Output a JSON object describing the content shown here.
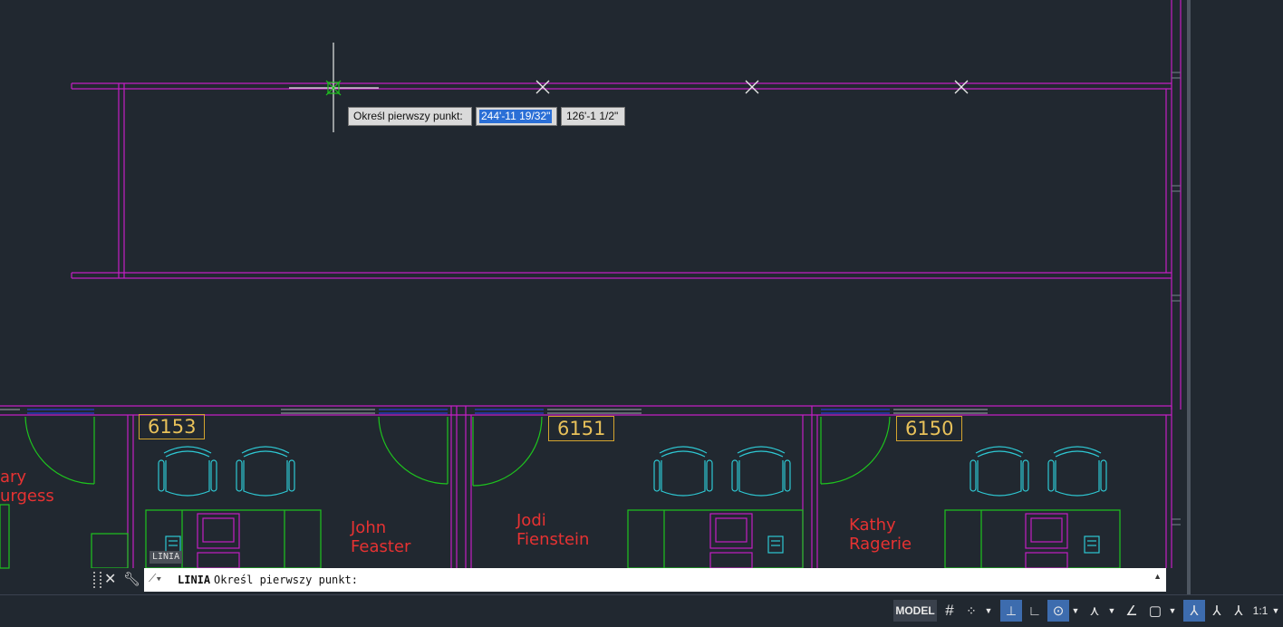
{
  "drawing": {
    "rooms": [
      {
        "number": "6153"
      },
      {
        "number": "6151"
      },
      {
        "number": "6150"
      }
    ],
    "occupants": [
      {
        "line1": "ary",
        "line2": "urgess"
      },
      {
        "line1": "John",
        "line2": "Feaster"
      },
      {
        "line1": "Jodi",
        "line2": "Fienstein"
      },
      {
        "line1": "Kathy",
        "line2": "Ragerie"
      }
    ],
    "cursor_badge": "LINIA"
  },
  "dynamic_input": {
    "prompt": "Określ pierwszy punkt:",
    "x_value": "244'-11 19/32\"",
    "y_value": "126'-1 1/2\""
  },
  "command_line": {
    "command": "LINIA",
    "prompt": "Określ pierwszy punkt:"
  },
  "status_bar": {
    "model_label": "MODEL",
    "scale_label": "1:1"
  },
  "colors": {
    "background": "#212830",
    "walls": "#c41ec4",
    "doors": "#1ec41e",
    "furniture": "#2ec9d4",
    "room_label": "#e8c15a",
    "occupant_text": "#e63232",
    "windows": "#2a3ad4"
  }
}
